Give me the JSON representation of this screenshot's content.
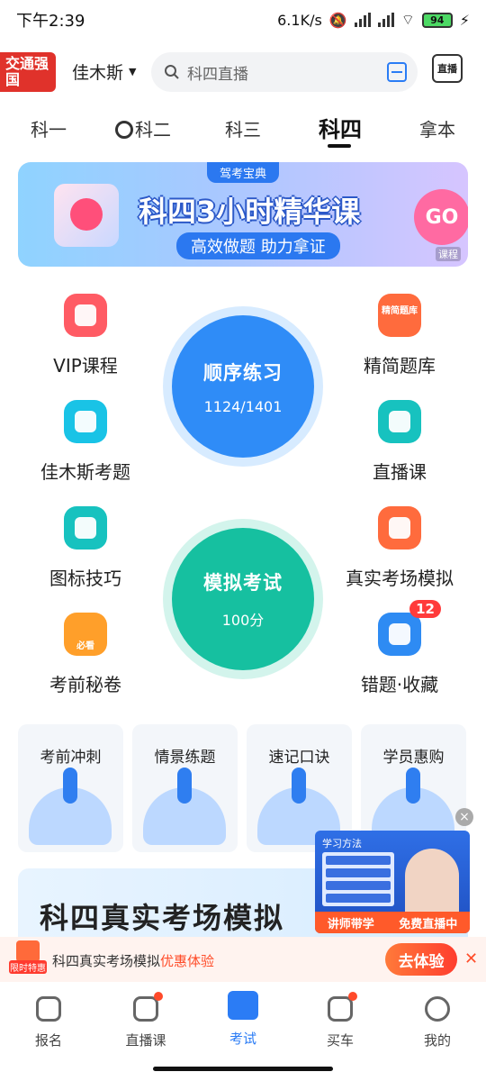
{
  "status_bar": {
    "time": "下午2:39",
    "speed": "6.1K/s",
    "battery": "94"
  },
  "header": {
    "logo_text": "交通强国",
    "city": "佳木斯",
    "search_placeholder": "科四直播",
    "live_label": "直播"
  },
  "tabs": [
    "科一",
    "科二",
    "科三",
    "科四",
    "拿本"
  ],
  "active_tab": "科四",
  "banner": {
    "badge": "驾考宝典",
    "title": "科四3小时精华课",
    "subtitle": "高效做题  助力拿证",
    "go": "GO",
    "tag": "课程"
  },
  "features": {
    "vip": "VIP课程",
    "local": "佳木斯考题",
    "icon_tips": "图标技巧",
    "secret": "考前秘卷",
    "secret_badge": "必看",
    "refined": "精简题库",
    "refined_icon_text": "精简题库",
    "live": "直播课",
    "real_sim": "真实考场模拟",
    "mistakes": "错题·收藏",
    "mistakes_count": "12"
  },
  "practice": {
    "title": "顺序练习",
    "progress_text": "1124/1401",
    "done": 1124,
    "total": 1401
  },
  "mock_exam": {
    "title": "模拟考试",
    "score": "100分"
  },
  "quick_cards": [
    "考前冲刺",
    "情景练题",
    "速记口诀",
    "学员惠购"
  ],
  "promo_card_title": "科四真实考场模拟",
  "video": {
    "header": "学习方法",
    "items": [
      "1.听3小时精华课",
      "2.刷精简500题",
      "3.刷真实考场模拟",
      "4.考前刷秘卷复习"
    ],
    "side_text": "高效备考",
    "left_label": "讲师带学",
    "right_label": "免费直播中"
  },
  "offer": {
    "tag": "限时特惠",
    "text": "科四真实考场模拟",
    "highlight": "优惠体验",
    "cta": "去体验"
  },
  "bottom_nav": [
    {
      "label": "报名",
      "dot": false
    },
    {
      "label": "直播课",
      "dot": true
    },
    {
      "label": "考试",
      "dot": false,
      "active": true
    },
    {
      "label": "买车",
      "dot": true
    },
    {
      "label": "我的",
      "dot": false
    }
  ],
  "colors": {
    "accent": "#2b7cf5",
    "practice": "#2f8cf7",
    "mock": "#16c0a0",
    "offer": "#ff4d2a"
  }
}
